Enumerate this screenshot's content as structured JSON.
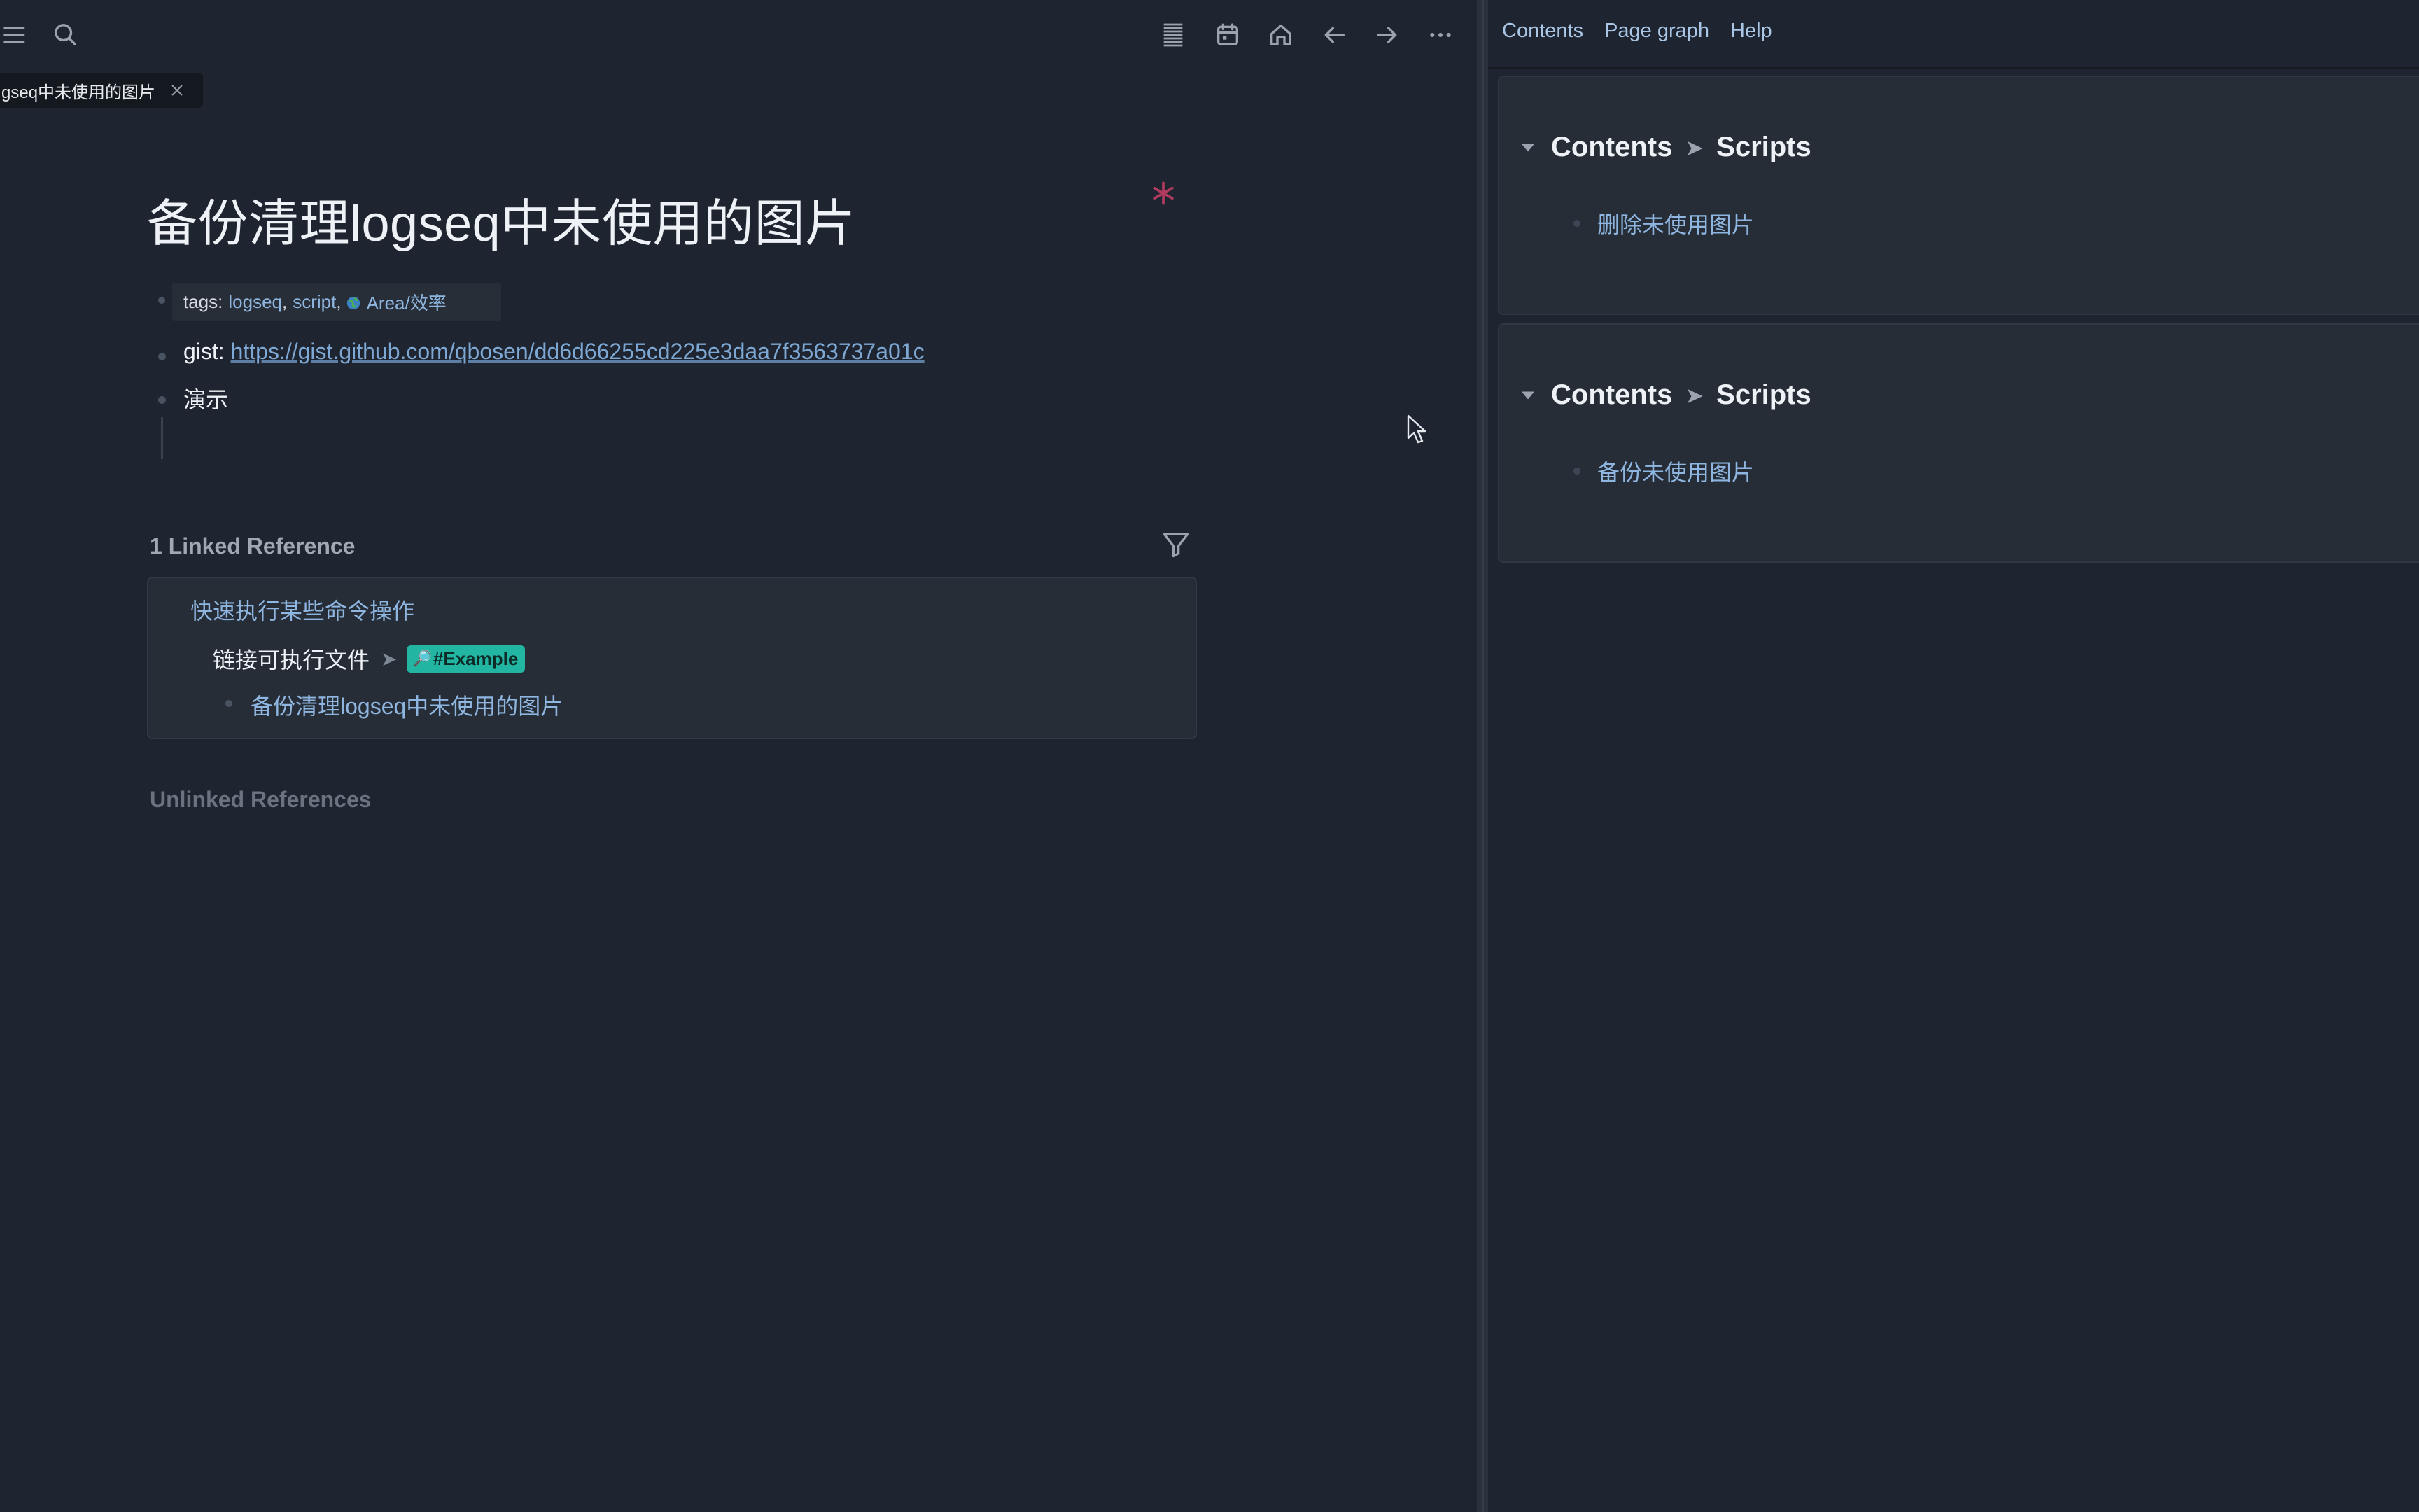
{
  "tab": {
    "label": "gseq中未使用的图片"
  },
  "page": {
    "title": "备份清理logseq中未使用的图片",
    "properties": {
      "tags_label": "tags:",
      "tags": [
        "logseq",
        "script",
        "Area/效率"
      ],
      "separator": ","
    },
    "gist_label": "gist:",
    "gist_url": "https://gist.github.com/qbosen/dd6d66255cd225e3daa7f3563737a01c",
    "demo_label": "演示"
  },
  "linked_references": {
    "title": "1 Linked Reference",
    "page_link": "快速执行某些命令操作",
    "breadcrumb_parent": "链接可执行文件",
    "breadcrumb_tag": "#Example",
    "child": "备份清理logseq中未使用的图片"
  },
  "unlinked_references": {
    "title": "Unlinked References"
  },
  "right_sidebar": {
    "tabs": [
      "Contents",
      "Page graph",
      "Help"
    ],
    "cards": [
      {
        "crumb_parent": "Contents",
        "crumb_child": "Scripts",
        "item": "删除未使用图片"
      },
      {
        "crumb_parent": "Contents",
        "crumb_child": "Scripts",
        "item": "备份未使用图片"
      }
    ]
  },
  "icons": {
    "topbar_left": [
      "menu-icon",
      "search-icon"
    ],
    "topbar_right": [
      "list-icon",
      "calendar-icon",
      "home-icon",
      "arrow-left-icon",
      "arrow-right-icon",
      "more-icon"
    ]
  },
  "colors": {
    "background": "#1f2530",
    "link": "#8fb6e0",
    "tag_bg": "#21b5a2",
    "star": "#b23a5e"
  }
}
